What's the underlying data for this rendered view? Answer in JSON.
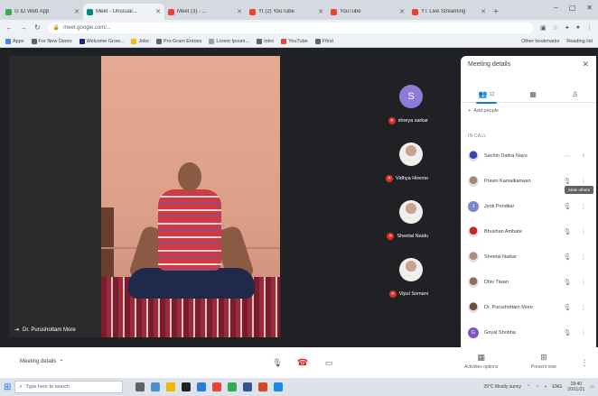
{
  "browser": {
    "tabs": [
      {
        "label": "G ID Web App",
        "color": "#34a853",
        "active": false
      },
      {
        "label": "Meet - Unusual...",
        "color": "#00897b",
        "active": true
      },
      {
        "label": "Meet (3) - ...",
        "color": "#ea4335",
        "active": false
      },
      {
        "label": "Yt (2) YouTube",
        "color": "#ea4335",
        "active": false
      },
      {
        "label": "YouTube",
        "color": "#ea4335",
        "active": false
      },
      {
        "label": "YT Live Streaming",
        "color": "#ea4335",
        "active": false
      }
    ],
    "new_tab": "+",
    "address": "meet.google.com/...",
    "bookmarks": [
      {
        "label": "Apps",
        "color": "#4285f4"
      },
      {
        "label": "For New Demo",
        "color": "#5f6368"
      },
      {
        "label": "Welcome Grow...",
        "color": "#1a237e"
      },
      {
        "label": "Jobs",
        "color": "#fbbc04"
      },
      {
        "label": "Pro Gram Entries",
        "color": "#5f6368"
      },
      {
        "label": "Lorem Ipsum...",
        "color": "#9aa0a6"
      },
      {
        "label": "Intro",
        "color": "#5f6368"
      },
      {
        "label": "YouTube",
        "color": "#ea4335"
      },
      {
        "label": "Ffirst",
        "color": "#5f6368"
      }
    ],
    "bookmarks_right": [
      "Other bookmarks",
      "Reading list"
    ]
  },
  "meet": {
    "main_participant": "Dr. Purushottam More",
    "tiles": [
      {
        "name": "shreya sarkar",
        "initial": "S",
        "avatar_color": "#8e7ad8",
        "photo": false
      },
      {
        "name": "Vidhya Hiremo",
        "initial": "",
        "avatar_color": "#c9a38d",
        "photo": true
      },
      {
        "name": "Sheetal Naidu",
        "initial": "",
        "avatar_color": "#c9a38d",
        "photo": true
      },
      {
        "name": "Vipul Somani",
        "initial": "",
        "avatar_color": "#c9a38d",
        "photo": true
      }
    ]
  },
  "panel": {
    "title": "Meeting details",
    "tab_count": "12",
    "add_people": "Add people",
    "in_call": "IN CALL",
    "tooltip": "Mute others",
    "participants": [
      {
        "name": "Sachin Dattra Nayu",
        "initial": "",
        "color": "#3949ab",
        "photo": true
      },
      {
        "name": "Pravin Kamalkanwan",
        "initial": "",
        "color": "#a1887f",
        "photo": true
      },
      {
        "name": "Jyoti Pendkar",
        "initial": "J",
        "color": "#7986cb",
        "photo": false
      },
      {
        "name": "Bhushan Ambate",
        "initial": "",
        "color": "#c62828",
        "photo": true
      },
      {
        "name": "Sheetal Naikar",
        "initial": "",
        "color": "#ad8c7b",
        "photo": true
      },
      {
        "name": "Dhiv Tiwari",
        "initial": "",
        "color": "#8d6e63",
        "photo": true
      },
      {
        "name": "Dr. Purushottam More",
        "initial": "",
        "color": "#6d4c41",
        "photo": true
      },
      {
        "name": "Goyal Shobha",
        "initial": "G",
        "color": "#7e57c2",
        "photo": false
      }
    ]
  },
  "meetbar": {
    "details": "Meeting details",
    "activities": "Activities options",
    "present": "Present now"
  },
  "taskbar": {
    "search_placeholder": "Type here to search",
    "weather": "29°C Mostly sunny",
    "lang": "ENG",
    "time": "18:40",
    "date": "20/11/21"
  }
}
